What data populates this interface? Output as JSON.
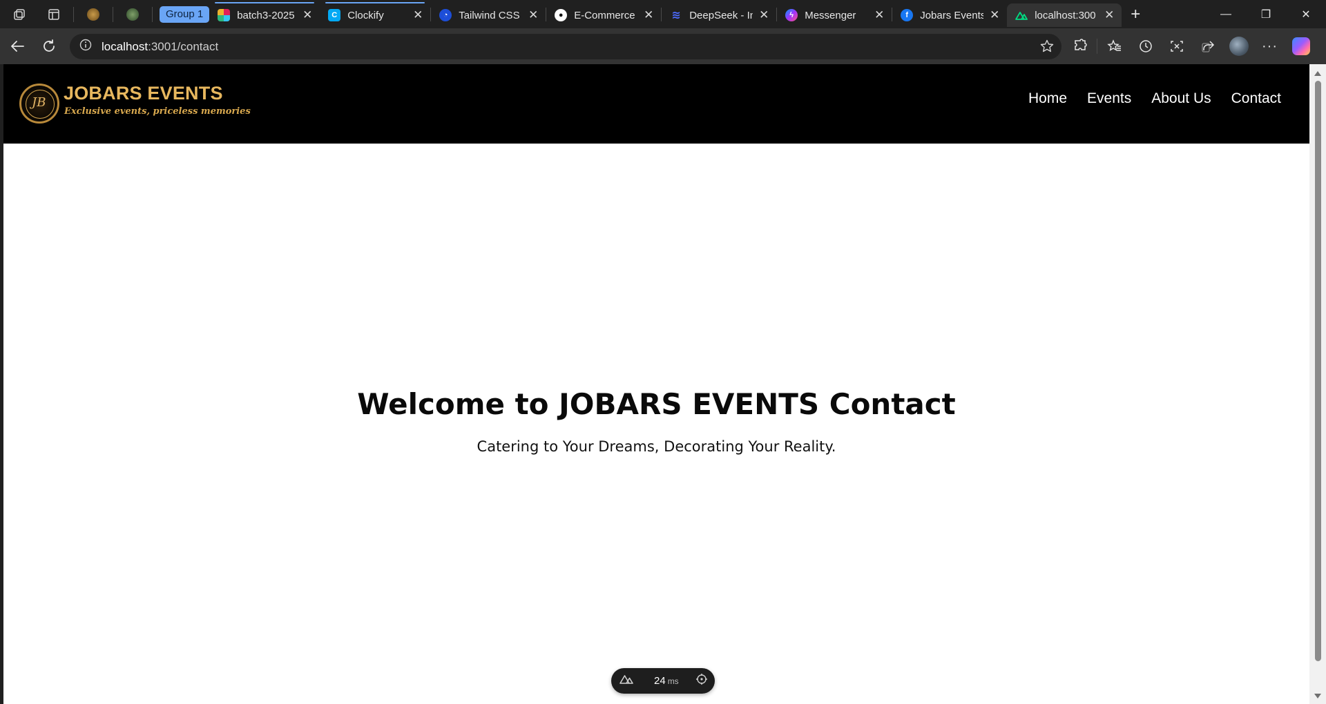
{
  "browser": {
    "tab_group_label": "Group 1",
    "tabs": [
      {
        "title": "batch3-2025",
        "icon": "slack-icon"
      },
      {
        "title": "Clockify",
        "icon": "clockify-icon"
      },
      {
        "title": "Tailwind CSS",
        "icon": "tailwind-icon"
      },
      {
        "title": "E-Commerce",
        "icon": "github-icon"
      },
      {
        "title": "DeepSeek - In",
        "icon": "deepseek-icon"
      },
      {
        "title": "Messenger",
        "icon": "messenger-icon"
      },
      {
        "title": "Jobars Events",
        "icon": "facebook-icon"
      },
      {
        "title": "localhost:300",
        "icon": "nuxt-icon"
      }
    ],
    "address": {
      "host": "localhost",
      "path": ":3001/contact"
    }
  },
  "site": {
    "logo": {
      "title": "JOBARS EVENTS",
      "tagline": "Exclusive events, priceless memories",
      "monogram": "JB"
    },
    "nav": [
      {
        "label": "Home"
      },
      {
        "label": "Events"
      },
      {
        "label": "About Us"
      },
      {
        "label": "Contact"
      }
    ],
    "hero": {
      "title": "Welcome to JOBARS EVENTS Contact",
      "subtitle": "Catering to Your Dreams, Decorating Your Reality."
    }
  },
  "devtools": {
    "render_time": "24",
    "unit": "ms"
  },
  "colors": {
    "nav_bg": "#000000",
    "logo_gold": "#e7b75e",
    "tab_group": "#6aa5f5"
  }
}
